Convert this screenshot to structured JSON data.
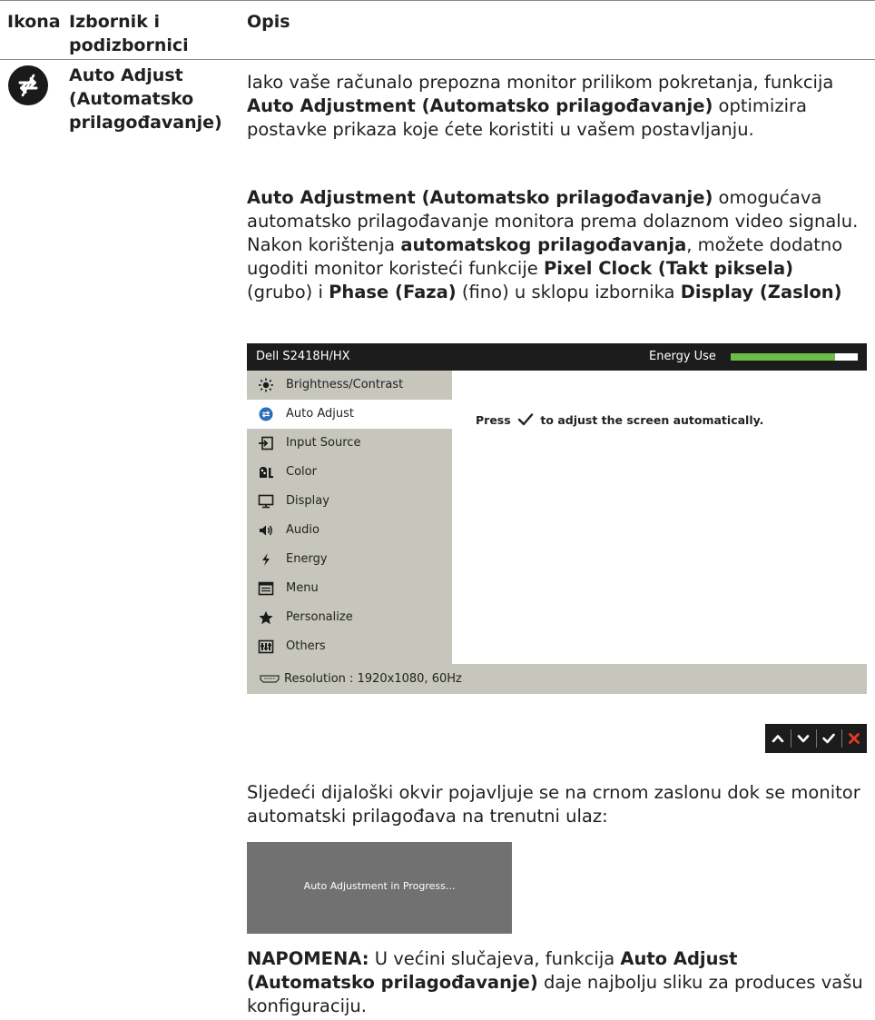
{
  "table": {
    "header_icon": "Ikona",
    "header_menu_line1": "Izbornik i",
    "header_menu_line2": "podizbornici",
    "header_desc": "Opis"
  },
  "row": {
    "icon_name": "auto-adjust-icon",
    "menu_line1": "Auto Adjust",
    "menu_line2": "(Automatsko",
    "menu_line3": "prilagođavanje)"
  },
  "p1": {
    "text1": "Iako vaše računalo prepozna monitor prilikom pokretanja, funkcija ",
    "bold1": "Auto Adjustment (Automatsko prilagođavanje)",
    "text2": " optimizira postavke prikaza koje ćete koristiti u vašem postavljanju."
  },
  "p2": {
    "bold1": "Auto Adjustment (Automatsko prilagođavanje)",
    "text1": " omogućava automatsko prilagođavanje monitora prema dolaznom video signalu. Nakon korištenja ",
    "bold2": "automatskog prilagođavanja",
    "text2": ", možete dodatno ugoditi monitor koristeći funkcije ",
    "bold3": "Pixel Clock (Takt piksela)",
    "text3": " (grubo) i ",
    "bold4": "Phase (Faza)",
    "text4": " (fino) u sklopu izbornika ",
    "bold5": "Display (Zaslon)"
  },
  "osd": {
    "model": "Dell S2418H/HX",
    "energy_label": "Energy Use",
    "energy_level": 0.82,
    "energy_color": "#6cbd45",
    "menu_items": [
      {
        "label": "Brightness/Contrast",
        "icon": "sun-icon"
      },
      {
        "label": "Auto Adjust",
        "icon": "auto-adjust-icon"
      },
      {
        "label": "Input Source",
        "icon": "input-source-icon"
      },
      {
        "label": "Color",
        "icon": "color-icon"
      },
      {
        "label": "Display",
        "icon": "display-icon"
      },
      {
        "label": "Audio",
        "icon": "speaker-icon"
      },
      {
        "label": "Energy",
        "icon": "energy-icon"
      },
      {
        "label": "Menu",
        "icon": "menu-icon"
      },
      {
        "label": "Personalize",
        "icon": "star-icon"
      },
      {
        "label": "Others",
        "icon": "others-icon"
      }
    ],
    "message_pre": "Press",
    "message_post": "to adjust the screen automatically.",
    "status": "Resolution : 1920x1080, 60Hz"
  },
  "nav_buttons": [
    "up-icon",
    "down-icon",
    "check-icon",
    "close-icon"
  ],
  "p3": {
    "text": "Sljedeći dijaloški okvir pojavljuje se na crnom zaslonu dok se monitor automatski prilagođava na trenutni ulaz:"
  },
  "dialog": {
    "text": "Auto Adjustment in Progress..."
  },
  "note": {
    "label": "NAPOMENA:",
    "text1": " U većini slučajeva, funkcija ",
    "bold1": "Auto Adjust (Automatsko prilagođavanje)",
    "text2": " daje najbolju sliku za produces vašu konfiguraciju."
  }
}
